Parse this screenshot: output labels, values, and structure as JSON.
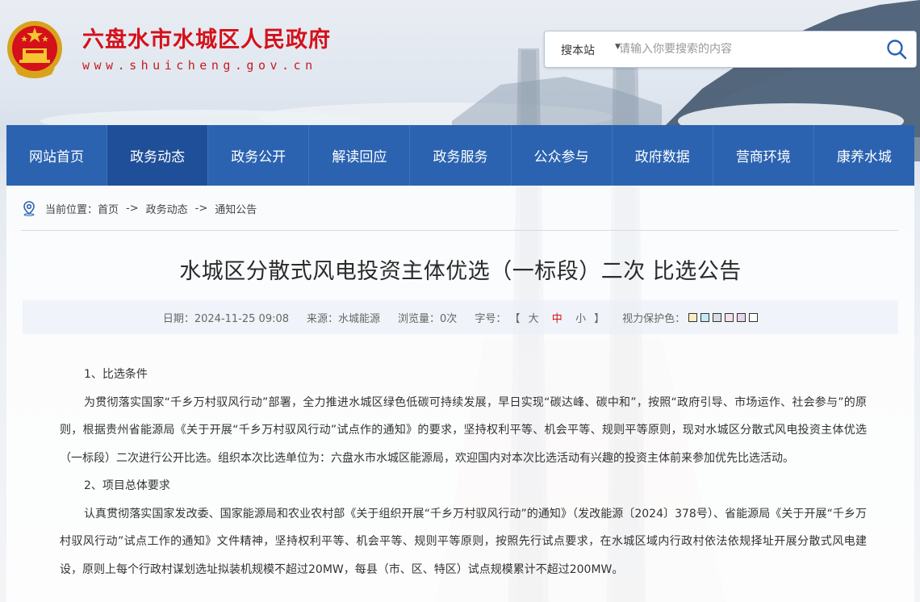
{
  "site": {
    "title": "六盘水市水城区人民政府",
    "domain": "www.shuicheng.gov.cn"
  },
  "search": {
    "scope_label": "搜本站",
    "placeholder": "请输入你要搜索的内容"
  },
  "nav": {
    "items": [
      "网站首页",
      "政务动态",
      "政务公开",
      "解读回应",
      "政务服务",
      "公众参与",
      "政府数据",
      "营商环境",
      "康养水城"
    ],
    "active_index": 1
  },
  "breadcrumb": {
    "label": "当前位置：",
    "items": [
      "首页",
      "政务动态",
      "通知公告"
    ],
    "separator": "->"
  },
  "article": {
    "title": "水城区分散式风电投资主体优选（一标段）二次 比选公告",
    "meta": {
      "date": "日期：2024-11-25 09:08",
      "source": "来源：水城能源",
      "views": "浏览量：0次",
      "font_size_label": "字号：",
      "bracket_open": "【",
      "bracket_close": "】",
      "font_sizes": [
        "大",
        "中",
        "小"
      ],
      "eye_care_label": "视力保护色：",
      "eye_care_colors": [
        "#fbeec2",
        "#c6e8f4",
        "#d9dde3",
        "#f7dfe6",
        "#e6d5ee",
        "#ffffff"
      ]
    },
    "paragraphs": [
      "1、比选条件",
      "为贯彻落实国家“千乡万村驭风行动”部署，全力推进水城区绿色低碳可持续发展，早日实现“碳达峰、碳中和”，按照“政府引导、市场运作、社会参与”的原则，根据贵州省能源局《关于开展“千乡万村驭风行动”试点作的通知》的要求，坚持权利平等、机会平等、规则平等原则，现对水城区分散式风电投资主体优选（一标段）二次进行公开比选。组织本次比选单位为：六盘水市水城区能源局，欢迎国内对本次比选活动有兴趣的投资主体前来参加优先比选活动。",
      "2、项目总体要求",
      "认真贯彻落实国家发改委、国家能源局和农业农村部《关于组织开展“千乡万村驭风行动”的通知》（发改能源〔2024〕378号）、省能源局《关于开展“千乡万村驭风行动”试点工作的通知》文件精神，坚持权利平等、机会平等、规则平等原则，按照先行试点要求，在水城区域内行政村依法依规择址开展分散式风电建设，原则上每个行政村谋划选址拟装机规模不超过20MW，每县（市、区、特区）试点规模累计不超过200MW。"
    ]
  },
  "colors": {
    "brand_red": "#d4111a",
    "nav_blue": "#2b63b1",
    "nav_active": "#1f4f99"
  }
}
